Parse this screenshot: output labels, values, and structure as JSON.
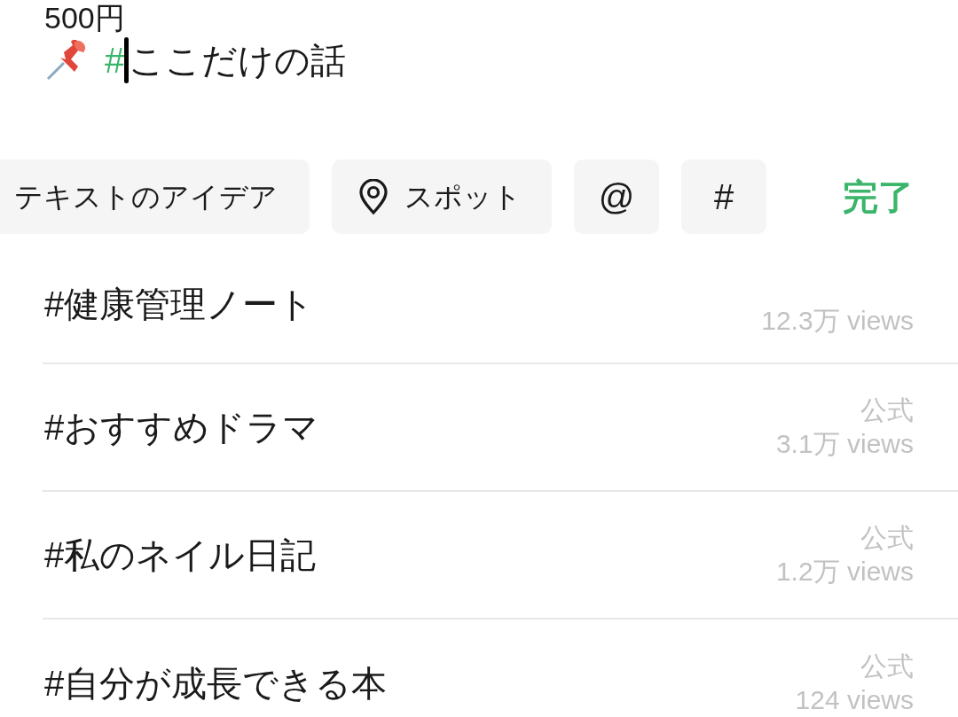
{
  "composer": {
    "price_line": "500円",
    "hashtag": {
      "mark": "#",
      "text": "ここだけの話",
      "cursor": true
    }
  },
  "toolbar": {
    "chips": [
      {
        "kind": "text",
        "label": "テキストのアイデア"
      },
      {
        "kind": "spot",
        "label": "スポット"
      },
      {
        "kind": "symbol",
        "label": "@"
      },
      {
        "kind": "symbol",
        "label": "#"
      }
    ],
    "done_button": "完了"
  },
  "tags": [
    {
      "name": "#健康管理ノート",
      "views": "12.3万 views"
    },
    {
      "name": "#おすすめドラマ",
      "badge": "公式",
      "views": "3.1万 views"
    },
    {
      "name": "#私のネイル日記",
      "badge": "公式",
      "views": "1.2万 views"
    },
    {
      "name": "#自分が成長できる本",
      "badge": "公式",
      "views": "124 views"
    }
  ]
}
